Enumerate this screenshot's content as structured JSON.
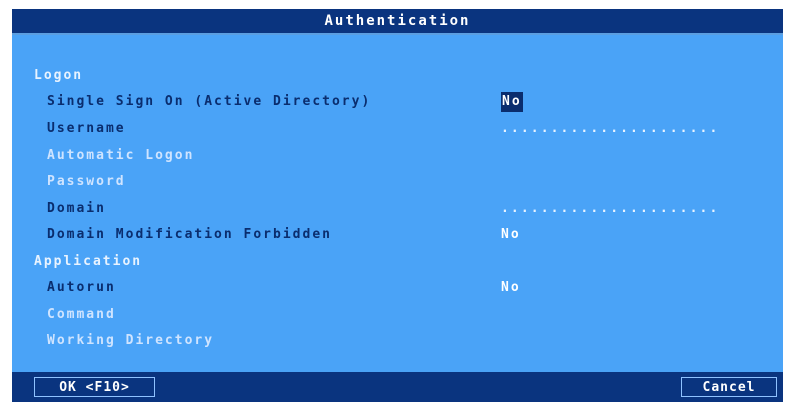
{
  "dialog": {
    "title": "Authentication"
  },
  "logon": {
    "section_label": "Logon",
    "single_sign_on": {
      "label": "Single Sign On (Active Directory)",
      "value": "No"
    },
    "username": {
      "label": "Username",
      "value": "......................"
    },
    "automatic_logon": {
      "label": "Automatic Logon"
    },
    "password": {
      "label": "Password"
    },
    "domain": {
      "label": "Domain",
      "value": "......................"
    },
    "domain_modification_forbidden": {
      "label": "Domain Modification Forbidden",
      "value": "No"
    }
  },
  "application": {
    "section_label": "Application",
    "autorun": {
      "label": "Autorun",
      "value": "No"
    },
    "command": {
      "label": "Command"
    },
    "working_directory": {
      "label": "Working Directory"
    }
  },
  "buttons": {
    "ok_label": "OK <F10>",
    "cancel_label": "Cancel"
  },
  "colors": {
    "dialog_background": "#4aa3f7",
    "titlebar_background": "#0a347f",
    "active_label": "#0a2d6e",
    "inactive_label": "#cfe4ff",
    "selected_value_background": "#0a2d6e"
  }
}
